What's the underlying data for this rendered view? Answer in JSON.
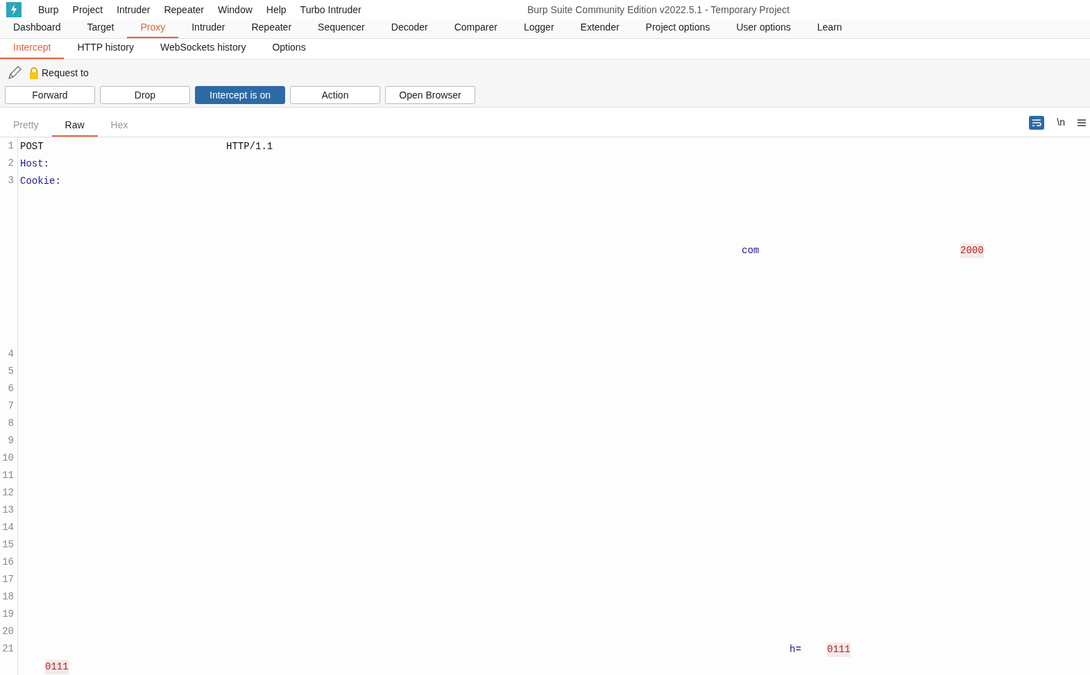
{
  "window": {
    "title": "Burp Suite Community Edition v2022.5.1 - Temporary Project"
  },
  "menu": [
    "Burp",
    "Project",
    "Intruder",
    "Repeater",
    "Window",
    "Help",
    "Turbo Intruder"
  ],
  "tabs": [
    {
      "label": "Dashboard",
      "selected": false
    },
    {
      "label": "Target",
      "selected": false
    },
    {
      "label": "Proxy",
      "selected": true
    },
    {
      "label": "Intruder",
      "selected": false
    },
    {
      "label": "Repeater",
      "selected": false
    },
    {
      "label": "Sequencer",
      "selected": false
    },
    {
      "label": "Decoder",
      "selected": false
    },
    {
      "label": "Comparer",
      "selected": false
    },
    {
      "label": "Logger",
      "selected": false
    },
    {
      "label": "Extender",
      "selected": false
    },
    {
      "label": "Project options",
      "selected": false
    },
    {
      "label": "User options",
      "selected": false
    },
    {
      "label": "Learn",
      "selected": false
    }
  ],
  "subtabs": [
    {
      "label": "Intercept",
      "selected": true
    },
    {
      "label": "HTTP history",
      "selected": false
    },
    {
      "label": "WebSockets history",
      "selected": false
    },
    {
      "label": "Options",
      "selected": false
    }
  ],
  "request_label": "Request to",
  "buttons": [
    {
      "label": "Forward",
      "selected": false
    },
    {
      "label": "Drop",
      "selected": false
    },
    {
      "label": "Intercept is on",
      "selected": true
    },
    {
      "label": "Action",
      "selected": false
    },
    {
      "label": "Open Browser",
      "selected": false
    }
  ],
  "view_tabs": [
    {
      "label": "Pretty",
      "selected": false
    },
    {
      "label": "Raw",
      "selected": true
    },
    {
      "label": "Hex",
      "selected": false
    }
  ],
  "newline_toggle": "\\n",
  "editor": {
    "lines": [
      {
        "kind": "line",
        "number": "1",
        "segments": [
          {
            "text": "POST",
            "kind": "plain"
          },
          {
            "text": "HTTP/1.1",
            "kind": "plain"
          }
        ]
      },
      {
        "kind": "line",
        "number": "2",
        "segments": [
          {
            "text": "Host:",
            "kind": "key"
          }
        ]
      },
      {
        "kind": "line",
        "number": "3",
        "segments": [
          {
            "text": "Cookie:",
            "kind": "key"
          }
        ]
      },
      {
        "kind": "wrap"
      },
      {
        "kind": "wrap"
      },
      {
        "kind": "wrap"
      },
      {
        "kind": "wrap",
        "segments": [
          {
            "text": "com",
            "kind": "key"
          },
          {
            "text": "2000",
            "kind": "value"
          }
        ]
      },
      {
        "kind": "wrap"
      },
      {
        "kind": "wrap"
      },
      {
        "kind": "wrap"
      },
      {
        "kind": "wrap"
      },
      {
        "kind": "wrap"
      },
      {
        "kind": "line",
        "number": "4"
      },
      {
        "kind": "line",
        "number": "5"
      },
      {
        "kind": "line",
        "number": "6"
      },
      {
        "kind": "line",
        "number": "7"
      },
      {
        "kind": "line",
        "number": "8"
      },
      {
        "kind": "line",
        "number": "9"
      },
      {
        "kind": "line",
        "number": "10"
      },
      {
        "kind": "line",
        "number": "11"
      },
      {
        "kind": "line",
        "number": "12"
      },
      {
        "kind": "line",
        "number": "13"
      },
      {
        "kind": "line",
        "number": "14"
      },
      {
        "kind": "line",
        "number": "15"
      },
      {
        "kind": "line",
        "number": "16"
      },
      {
        "kind": "line",
        "number": "17"
      },
      {
        "kind": "line",
        "number": "18"
      },
      {
        "kind": "line",
        "number": "19"
      },
      {
        "kind": "line",
        "number": "20"
      },
      {
        "kind": "line",
        "number": "21",
        "segments": [
          {
            "text": "h=",
            "kind": "key"
          },
          {
            "text": "0111",
            "kind": "value"
          }
        ]
      },
      {
        "kind": "wrap",
        "segments": [
          {
            "text": "0111",
            "kind": "value"
          }
        ]
      }
    ]
  }
}
